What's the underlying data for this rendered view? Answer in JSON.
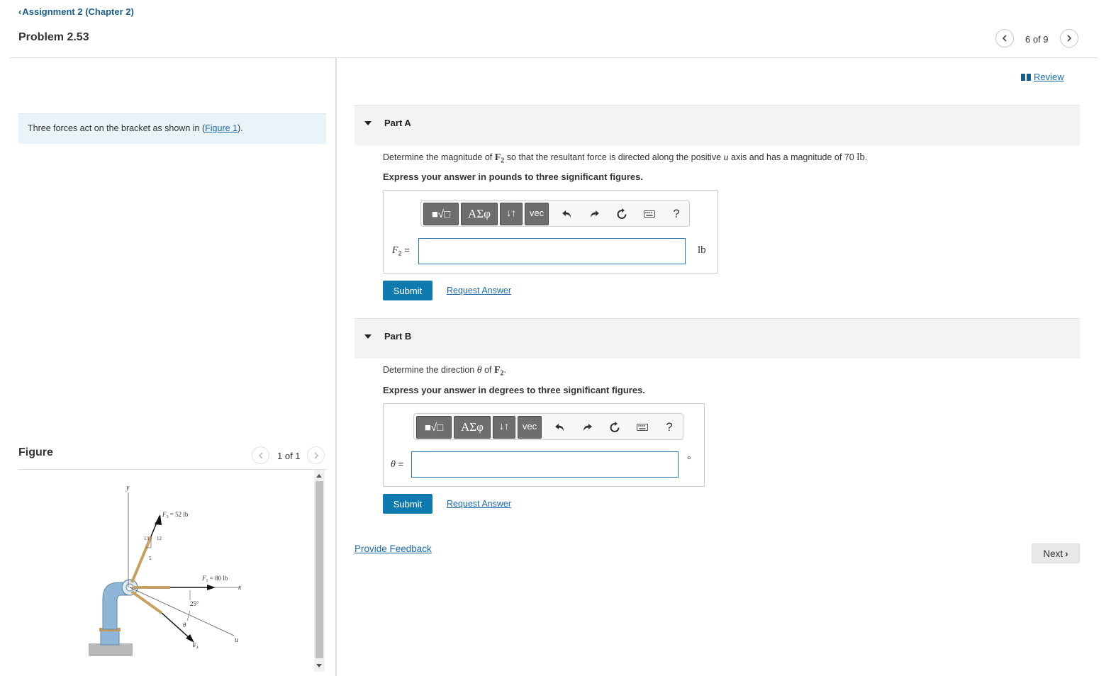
{
  "header": {
    "back_link": "Assignment 2 (Chapter 2)",
    "problem_title": "Problem 2.53",
    "pager": "6 of 9"
  },
  "review": {
    "label": "Review"
  },
  "intro": {
    "text": "Three forces act on the bracket as shown in (",
    "figure_link": "Figure 1",
    "end": ")."
  },
  "figure": {
    "title": "Figure",
    "pager": "1 of 1",
    "labels": {
      "y_axis": "y",
      "x_axis": "x",
      "u_axis": "u",
      "f3": "F",
      "f3_sub": "3",
      "f3_val": " = 52 lb",
      "f1": "F",
      "f1_sub": "1",
      "f1_val": " = 80 lb",
      "f2": "F",
      "f2_sub": "2",
      "angle_25": "25°",
      "theta": "θ",
      "tri_13": "13",
      "tri_12": "12",
      "tri_5": "5"
    }
  },
  "part_a": {
    "header": "Part A",
    "prompt_pre": "Determine the magnitude of ",
    "prompt_var": "F",
    "prompt_sub": "2",
    "prompt_mid": " so that the resultant force is directed along the positive ",
    "prompt_u": "u",
    "prompt_post": " axis and has a magnitude of 70 ",
    "prompt_unit": "lb",
    "prompt_end": ".",
    "instruction": "Express your answer in pounds to three significant figures.",
    "var_label": "F",
    "var_sub": "2",
    "var_eq": " =",
    "input_value": "",
    "unit": "lb",
    "submit": "Submit",
    "request": "Request Answer"
  },
  "part_b": {
    "header": "Part B",
    "prompt_pre": "Determine the direction ",
    "prompt_theta": "θ",
    "prompt_mid": " of ",
    "prompt_var": "F",
    "prompt_sub": "2",
    "prompt_end": ".",
    "instruction": "Express your answer in degrees to three significant figures.",
    "var_label": "θ",
    "var_eq": " =",
    "input_value": "",
    "unit": "°",
    "submit": "Submit",
    "request": "Request Answer"
  },
  "toolbar": {
    "templates": "■√□",
    "greek": "ΑΣφ",
    "arrows": "↓↑",
    "vec": "vec",
    "help": "?"
  },
  "footer": {
    "feedback": "Provide Feedback",
    "next": "Next"
  },
  "icons": [
    "chevron-left-icon",
    "chevron-right-icon",
    "book-icon",
    "undo-icon",
    "redo-icon",
    "reset-icon",
    "keyboard-icon",
    "help-icon",
    "collapse-triangle-icon"
  ],
  "colors": {
    "accent": "#0f7aad",
    "link": "#1a6aa8",
    "intro_bg": "#e8f4f8",
    "part_header_bg": "#f3f3f3"
  }
}
